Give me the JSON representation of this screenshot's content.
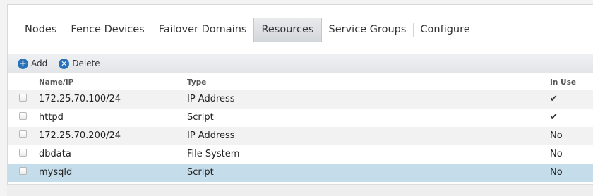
{
  "tabs": [
    {
      "label": "Nodes",
      "active": false
    },
    {
      "label": "Fence Devices",
      "active": false
    },
    {
      "label": "Failover Domains",
      "active": false
    },
    {
      "label": "Resources",
      "active": true
    },
    {
      "label": "Service Groups",
      "active": false
    },
    {
      "label": "Configure",
      "active": false
    }
  ],
  "toolbar": {
    "add_label": "Add",
    "delete_label": "Delete"
  },
  "table": {
    "columns": [
      "Name/IP",
      "Type",
      "In Use"
    ],
    "rows": [
      {
        "name": "172.25.70.100/24",
        "type": "IP Address",
        "in_use": "✔",
        "selected": false
      },
      {
        "name": "httpd",
        "type": "Script",
        "in_use": "✔",
        "selected": false
      },
      {
        "name": "172.25.70.200/24",
        "type": "IP Address",
        "in_use": "No",
        "selected": false
      },
      {
        "name": "dbdata",
        "type": "File System",
        "in_use": "No",
        "selected": false
      },
      {
        "name": "mysqld",
        "type": "Script",
        "in_use": "No",
        "selected": true
      }
    ]
  },
  "colors": {
    "accent": "#2a72b8",
    "selected_row": "#c5dcea"
  }
}
